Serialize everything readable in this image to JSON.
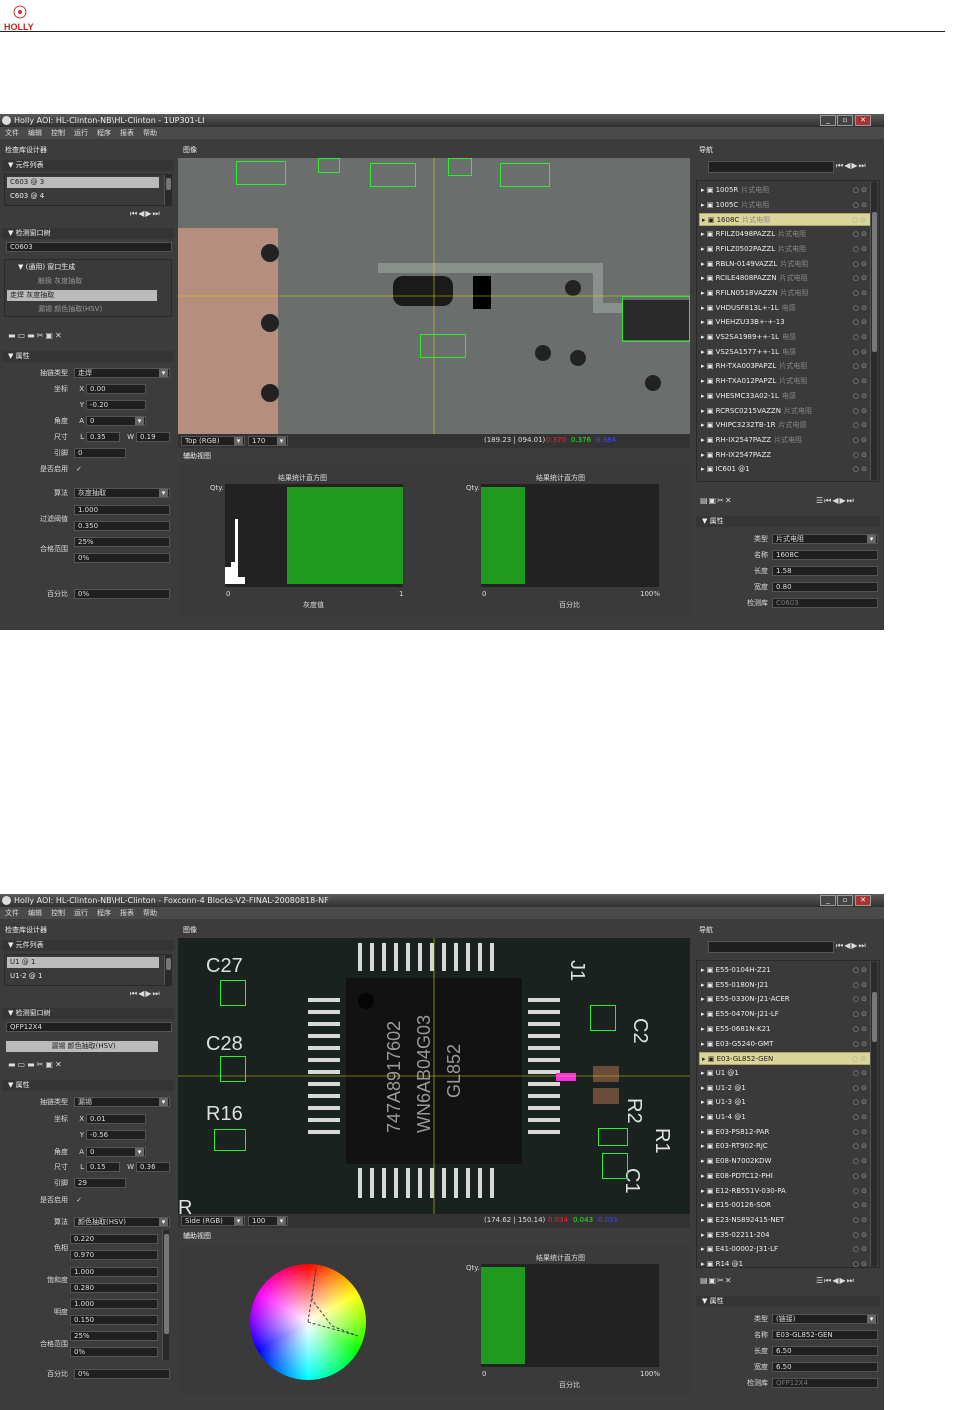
{
  "header": {
    "logo_text": "HOLLY"
  },
  "window1": {
    "title": "Holly AOI: HL-Clinton-NB\\HL-Clinton - 1UP301-LI",
    "menu": [
      "文件",
      "编辑",
      "控制",
      "运行",
      "程序",
      "报表",
      "帮助"
    ],
    "lib_designer": "检查库设计器",
    "comp_list": {
      "header": "▼ 元件列表",
      "items": [
        "C603  @ 3",
        "C603  @ 4"
      ]
    },
    "window_lib": {
      "header": "▼ 检测窗口树",
      "name": "C0603",
      "tree": [
        "▼ (通用)  窗口生成",
        "触极  灰度抽取",
        "走焊  灰度抽取",
        "漏锡  颜色抽取(HSV)"
      ]
    },
    "props": {
      "header": "▼ 属性",
      "algo_type_label": "抽链类型",
      "algo_type": "走焊",
      "coord_label": "坐标",
      "x": "0.00",
      "y": "-0.20",
      "angle_label": "角度",
      "angle": "0",
      "size_label": "尺寸",
      "L": "0.35",
      "W": "0.19",
      "ref_label": "引脚",
      "ref": "0",
      "enable_label": "是否启用",
      "algo_label": "算法",
      "algo": "灰度抽取",
      "filter_label": "过滤阈值",
      "filter_hi": "1.000",
      "filter_lo": "0.350",
      "pass_label": "合格范围",
      "pass_hi": "25%",
      "pass_lo": "0%",
      "percent_label": "百分比",
      "percent": "0%"
    },
    "image_label": "图像",
    "image_bar": {
      "view": "Top (RGB)",
      "value": "170",
      "coords": "(189.23 | 094.01)",
      "c1": "0.370",
      "c2": "0.376",
      "c3": "0.384"
    },
    "helper_label": "辅助视图",
    "hist1": {
      "title": "结果统计直方图",
      "y": "Qty.",
      "x0": "0",
      "x1": "1",
      "xlabel": "灰度值"
    },
    "hist2": {
      "title": "结果统计直方图",
      "y": "Qty.",
      "x0": "0",
      "x1": "100%",
      "xlabel": "百分比"
    },
    "nav_label": "导航",
    "nav": [
      {
        "t": "1005R",
        "s": "片式电阻"
      },
      {
        "t": "1005C",
        "s": "片式电阻"
      },
      {
        "t": "1608C",
        "s": "片式电阻",
        "sel": true
      },
      {
        "t": "RFILZ0498PAZZL",
        "s": "片式电阻"
      },
      {
        "t": "RFILZ0502PAZZL",
        "s": "片式电阻"
      },
      {
        "t": "RBLN-0149VAZZL",
        "s": "片式电阻"
      },
      {
        "t": "RCILE4808PAZZN",
        "s": "片式电阻"
      },
      {
        "t": "RFILN0518VAZZN",
        "s": "片式电阻"
      },
      {
        "t": "VHDUSF813L+-1L",
        "s": "电感"
      },
      {
        "t": "VHEHZU33B+-+-13",
        "s": ""
      },
      {
        "t": "VS2SA1989++-1L",
        "s": "电感"
      },
      {
        "t": "VS2SA1577++-1L",
        "s": "电感"
      },
      {
        "t": "RH-TXA003PAPZL",
        "s": "片式电阻"
      },
      {
        "t": "RH-TXA012PAPZL",
        "s": "片式电阻"
      },
      {
        "t": "VHESMC33A02-1L",
        "s": "电感"
      },
      {
        "t": "RCRSC0215VAZZN",
        "s": "片式电阻"
      },
      {
        "t": "VHIPC3232TB-1R",
        "s": "片式电感"
      },
      {
        "t": "RH-IX2547PAZZ",
        "s": "片式电阻"
      },
      {
        "t": "RH-IX2547PAZZ",
        "s": ""
      },
      {
        "t": "IC601 @1",
        "s": ""
      }
    ],
    "attr": {
      "header": "▼ 属性",
      "type_label": "类型",
      "type": "片式电阻",
      "name_label": "名称",
      "name": "1608C",
      "len_label": "长度",
      "len": "1.58",
      "wid_label": "宽度",
      "wid": "0.80",
      "lib_label": "检测库",
      "lib": "C0603"
    }
  },
  "window2": {
    "title": "Holly AOI: HL-Clinton-NB\\HL-Clinton - Foxconn-4 Blocks-V2-FINAL-20080818-NF",
    "menu": [
      "文件",
      "编辑",
      "控制",
      "运行",
      "程序",
      "报表",
      "帮助"
    ],
    "lib_designer": "检查库设计器",
    "comp_list": {
      "header": "▼ 元件列表",
      "items": [
        "U1  @ 1",
        "U1-2  @ 1"
      ]
    },
    "window_lib": {
      "header": "▼ 检测窗口树",
      "name": "QFP12X4",
      "tree": [
        "漏锡  颜色抽取(HSV)"
      ]
    },
    "props": {
      "header": "▼ 属性",
      "algo_type_label": "抽链类型",
      "algo_type": "漏锡",
      "coord_label": "坐标",
      "x": "0.01",
      "y": "-0.56",
      "angle_label": "角度",
      "angle": "0",
      "size_label": "尺寸",
      "L": "0.15",
      "W": "0.36",
      "ref_label": "引脚",
      "ref": "29",
      "enable_label": "是否启用",
      "algo_label": "算法",
      "algo": "颜色抽取(HSV)",
      "hue_label": "色相",
      "hue_hi": "0.220",
      "hue_lo": "0.970",
      "sat_label": "饱和度",
      "sat_hi": "1.000",
      "sat_lo": "0.280",
      "val_label": "明度",
      "val_hi": "1.000",
      "val_lo": "0.150",
      "pass_label": "合格范围",
      "pass_hi": "25%",
      "pass_lo": "0%",
      "percent_label": "百分比",
      "percent": "0%"
    },
    "image_label": "图像",
    "image_bar": {
      "view": "Side (RGB)",
      "value": "100",
      "coords": "(174.62 | 150.14)",
      "c1": "0.034",
      "c2": "0.043",
      "c3": "0.031"
    },
    "helper_label": "辅助视图",
    "hist2": {
      "title": "结果统计直方图",
      "y": "Qty.",
      "x0": "0",
      "x1": "100%",
      "xlabel": "百分比"
    },
    "pcb_labels": {
      "c27": "C27",
      "c28": "C28",
      "r16": "R16",
      "c2": "C2",
      "r2": "R2",
      "r1": "R1",
      "c1": "C1",
      "j1": "J1",
      "r": "R",
      "chip1": "GL852",
      "chip2": "WN6AB04G03",
      "chip3": "747A8917602"
    },
    "nav_label": "导航",
    "nav": [
      {
        "t": "E55-0104H-Z21",
        "s": ""
      },
      {
        "t": "E55-0180N-J21",
        "s": ""
      },
      {
        "t": "E55-0330N-J21-ACER",
        "s": ""
      },
      {
        "t": "E55-0470N-J21-LF",
        "s": ""
      },
      {
        "t": "E55-0681N-K21",
        "s": ""
      },
      {
        "t": "E03-G5240-GMT",
        "s": ""
      },
      {
        "t": "E03-GL852-GEN",
        "s": "",
        "sel": true
      },
      {
        "t": "U1 @1",
        "s": ""
      },
      {
        "t": "U1-2 @1",
        "s": ""
      },
      {
        "t": "U1-3 @1",
        "s": ""
      },
      {
        "t": "U1-4 @1",
        "s": ""
      },
      {
        "t": "E03-PS812-PAR",
        "s": ""
      },
      {
        "t": "E03-RT902-RJC",
        "s": ""
      },
      {
        "t": "E08-N7002KDW",
        "s": ""
      },
      {
        "t": "E08-PDTC12-PHI",
        "s": ""
      },
      {
        "t": "E12-RB551V-030-PA",
        "s": ""
      },
      {
        "t": "E15-00126-SOR",
        "s": ""
      },
      {
        "t": "E23-NS892415-NET",
        "s": ""
      },
      {
        "t": "E35-02211-204",
        "s": ""
      },
      {
        "t": "E41-00002-J31-LF",
        "s": ""
      },
      {
        "t": "R14 @1",
        "s": ""
      }
    ],
    "attr": {
      "header": "▼ 属性",
      "type_label": "类型",
      "type": "(链接)",
      "name_label": "名称",
      "name": "E03-GL852-GEN",
      "len_label": "长度",
      "len": "6.50",
      "wid_label": "宽度",
      "wid": "6.50",
      "lib_label": "检测库",
      "lib": "QFP12X4"
    }
  }
}
